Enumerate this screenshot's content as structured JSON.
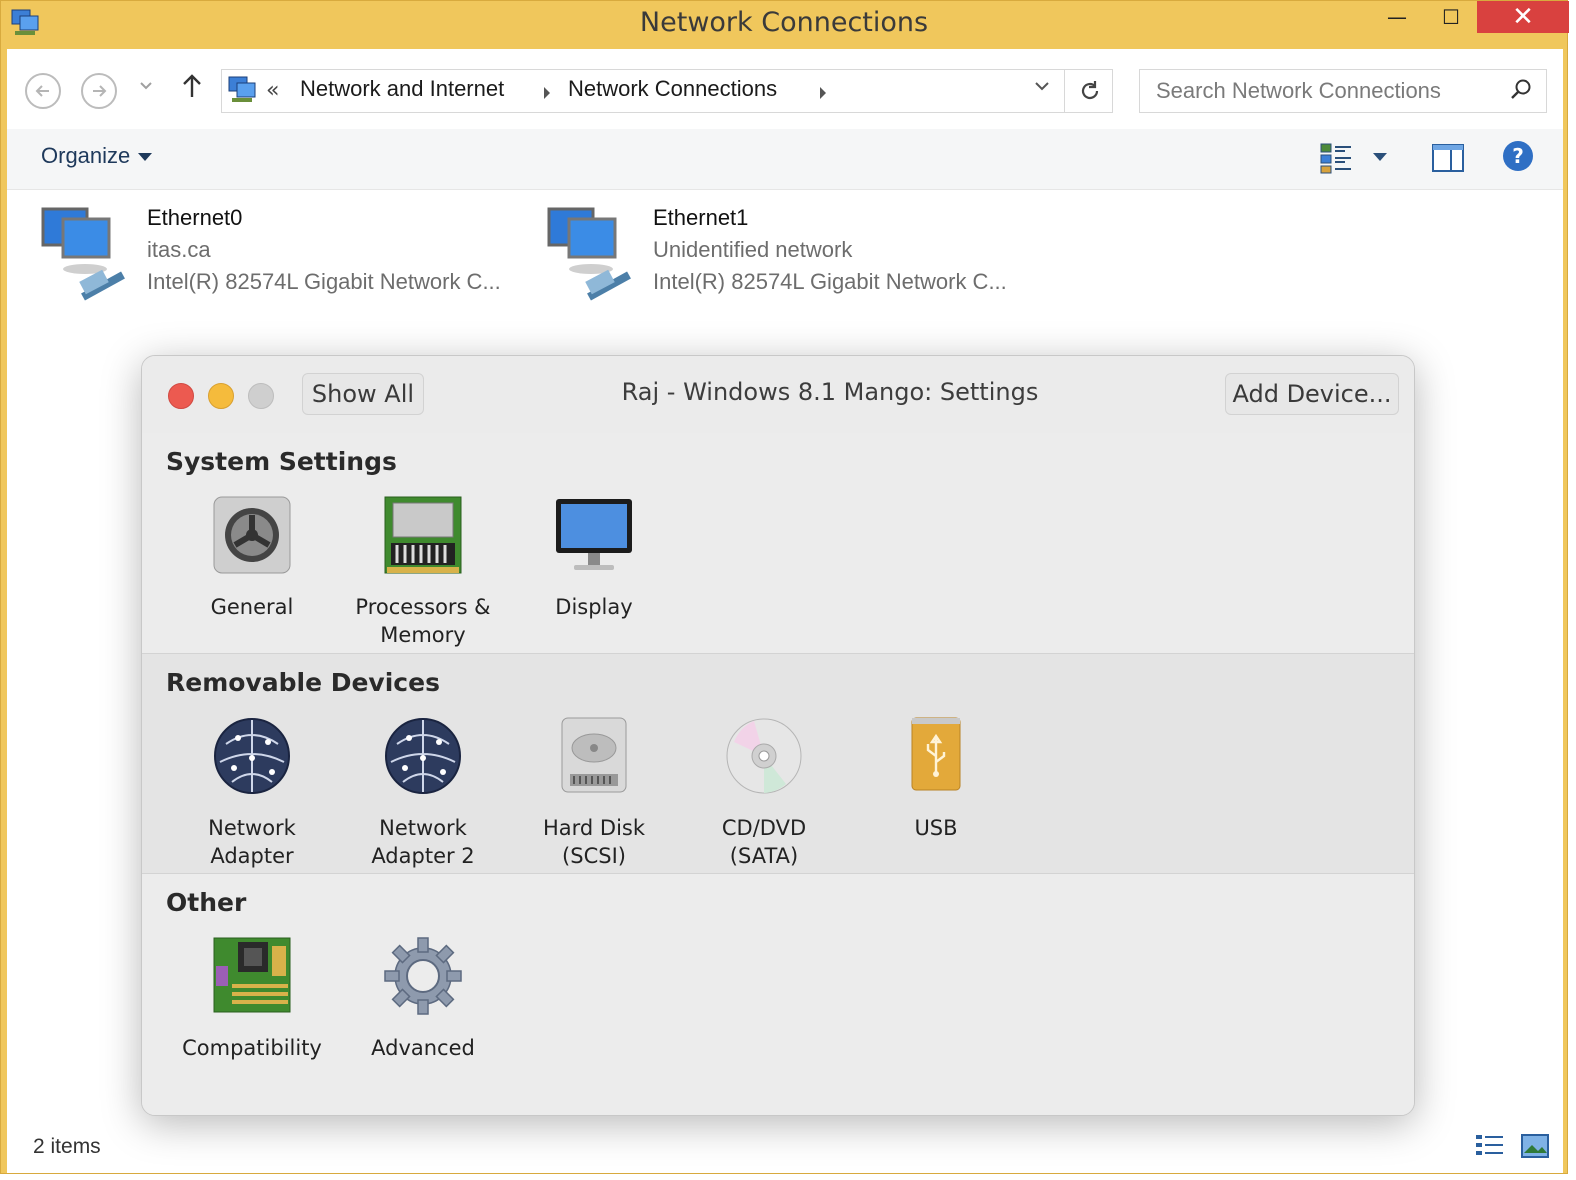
{
  "explorer": {
    "title": "Network Connections",
    "window_controls": {
      "minimize": "—",
      "maximize": "☐",
      "close": "✕"
    },
    "breadcrumb": {
      "overflow": "«",
      "items": [
        "Network and Internet",
        "Network Connections"
      ]
    },
    "search": {
      "placeholder": "Search Network Connections"
    },
    "toolbar": {
      "organize_label": "Organize"
    },
    "connections": [
      {
        "name": "Ethernet0",
        "network": "itas.ca",
        "device": "Intel(R) 82574L Gigabit Network C..."
      },
      {
        "name": "Ethernet1",
        "network": "Unidentified network",
        "device": "Intel(R) 82574L Gigabit Network C..."
      }
    ],
    "status": {
      "item_count": "2 items"
    },
    "colors": {
      "titlebar": "#f0c75c",
      "close": "#d9413f"
    }
  },
  "settings": {
    "title": "Raj - Windows 8.1 Mango: Settings",
    "show_all_label": "Show All",
    "add_device_label": "Add Device...",
    "sections": [
      {
        "title": "System Settings",
        "items": [
          {
            "label": "General",
            "icon": "gear-icon"
          },
          {
            "label": "Processors &\nMemory",
            "icon": "memory-chip-icon"
          },
          {
            "label": "Display",
            "icon": "monitor-icon"
          }
        ]
      },
      {
        "title": "Removable Devices",
        "items": [
          {
            "label": "Network\nAdapter",
            "icon": "globe-network-icon"
          },
          {
            "label": "Network\nAdapter 2",
            "icon": "globe-network-icon"
          },
          {
            "label": "Hard Disk\n(SCSI)",
            "icon": "hard-disk-icon"
          },
          {
            "label": "CD/DVD\n(SATA)",
            "icon": "cd-dvd-icon"
          },
          {
            "label": "USB",
            "icon": "usb-icon"
          }
        ]
      },
      {
        "title": "Other",
        "items": [
          {
            "label": "Compatibility",
            "icon": "motherboard-icon"
          },
          {
            "label": "Advanced",
            "icon": "cog-icon"
          }
        ]
      }
    ],
    "colors": {
      "close": "#ec5a50",
      "minimize": "#f5bb3c",
      "zoom": "#cfcfcf"
    }
  }
}
